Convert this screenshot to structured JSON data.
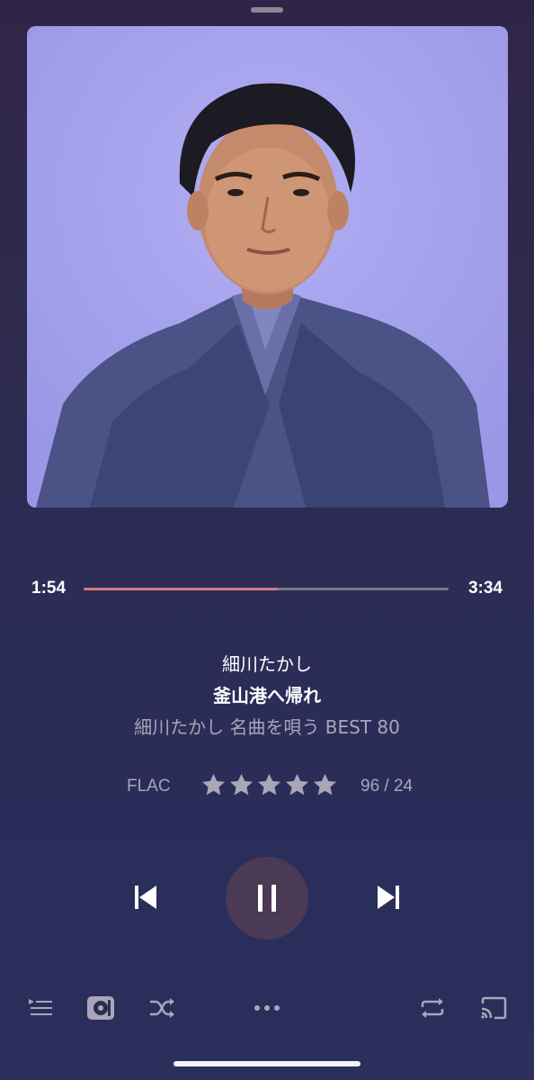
{
  "player": {
    "elapsed": "1:54",
    "total": "3:34",
    "progress_fraction": 0.533
  },
  "song": {
    "artist": "細川たかし",
    "title": "釜山港へ帰れ",
    "album": "細川たかし 名曲を唄う BEST 80"
  },
  "meta": {
    "format": "FLAC",
    "rating_stars": 5,
    "count": "96 / 24"
  },
  "colors": {
    "progress_played": "#d9787e",
    "progress_remaining": "#7a7785",
    "play_button_bg": "#4a3a55",
    "secondary_text": "#a9a6b8",
    "art_background": "#a3a0ee"
  },
  "icons": {
    "prev": "skip-previous-icon",
    "play_pause": "pause-icon",
    "next": "skip-next-icon",
    "queue": "queue-list-icon",
    "output": "speaker-output-icon",
    "shuffle": "shuffle-icon",
    "more": "more-dots-icon",
    "repeat": "repeat-icon",
    "cast": "cast-icon"
  }
}
